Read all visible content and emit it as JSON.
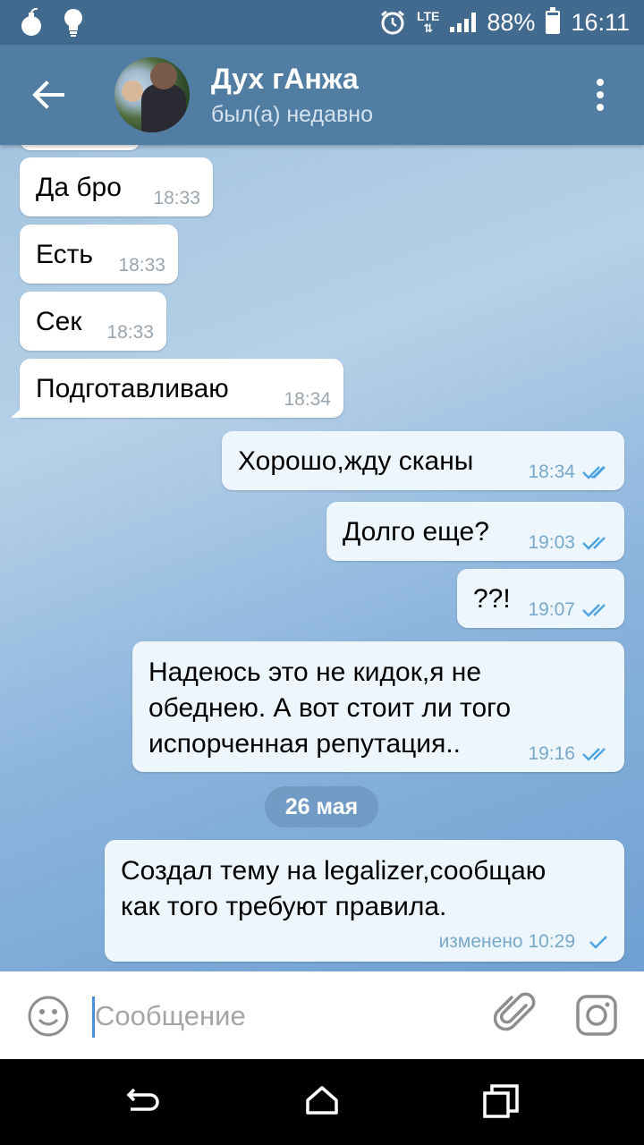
{
  "status_bar": {
    "network": "LTE",
    "battery": "88%",
    "battery_level": 0.88,
    "time": "16:11"
  },
  "header": {
    "contact_name": "Дух гАнжа",
    "contact_status": "был(а) недавно"
  },
  "messages": [
    {
      "dir": "in",
      "text": "Да бро",
      "time": "18:33"
    },
    {
      "dir": "in",
      "text": "Есть",
      "time": "18:33"
    },
    {
      "dir": "in",
      "text": "Сек",
      "time": "18:33"
    },
    {
      "dir": "in",
      "text": "Подготавливаю",
      "time": "18:34"
    },
    {
      "dir": "out",
      "text": "Хорошо,жду сканы",
      "time": "18:34",
      "read": true
    },
    {
      "dir": "out",
      "text": "Долго еще?",
      "time": "19:03",
      "read": true
    },
    {
      "dir": "out",
      "text": "??!",
      "time": "19:07",
      "read": true
    },
    {
      "dir": "out",
      "text": "Надеюсь это не кидок,я не\nобеднею. А вот стоит ли того\nиспорченная репутация..",
      "time": "19:16",
      "read": true
    },
    {
      "dir": "out",
      "text": "Создал тему на legalizer,сообщаю\nкак того требуют правила.",
      "time": "изменено 10:29",
      "read": false
    }
  ],
  "date_separator": "26 мая",
  "composer": {
    "placeholder": "Сообщение"
  },
  "icons": {
    "back": "arrow-left-icon",
    "menu": "more-vertical-icon",
    "emoji": "smiley-icon",
    "attach": "paperclip-icon",
    "camera": "camera-icon"
  },
  "colors": {
    "header": "#527da3",
    "status_bar": "#416a8e",
    "outgoing_bubble": "#eef6fd",
    "tick": "#4fa3e0"
  }
}
